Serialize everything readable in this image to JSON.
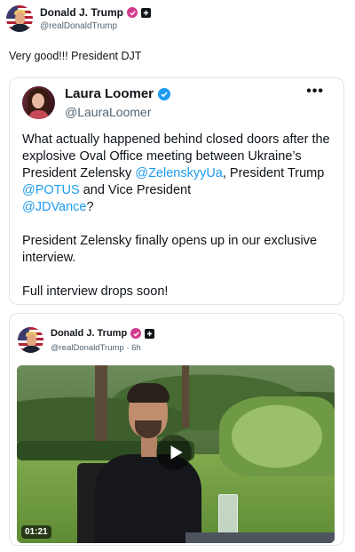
{
  "post": {
    "author_name": "Donald J. Trump",
    "author_handle": "@realDonaldTrump",
    "text": "Very good!!! President DJT"
  },
  "quote": {
    "author_name": "Laura Loomer",
    "author_handle": "@LauraLoomer",
    "more_label": "•••",
    "p1_a": "What actually happened behind closed doors after the explosive Oval Office meeting between Ukraine’s President Zelensky ",
    "p1_m1": "@ZelenskyyUa",
    "p1_b": ", President Trump ",
    "p1_m2": "@POTUS",
    "p1_c": " and Vice President ",
    "p1_m3": "@JDVance",
    "p1_d": "?",
    "p2": "President Zelensky finally opens up in our exclusive interview.",
    "p3": "Full interview drops soon!"
  },
  "embed": {
    "author_name": "Donald J. Trump",
    "author_handle_time": "@realDonaldTrump · 6h",
    "duration": "01:21"
  },
  "colors": {
    "mention": "#1d9bf0",
    "verified_pink": "#d13a8c",
    "verified_blue": "#1d9bf0"
  },
  "icons": [
    "verified-badge-icon",
    "square-badge-icon",
    "more-icon",
    "play-icon"
  ]
}
